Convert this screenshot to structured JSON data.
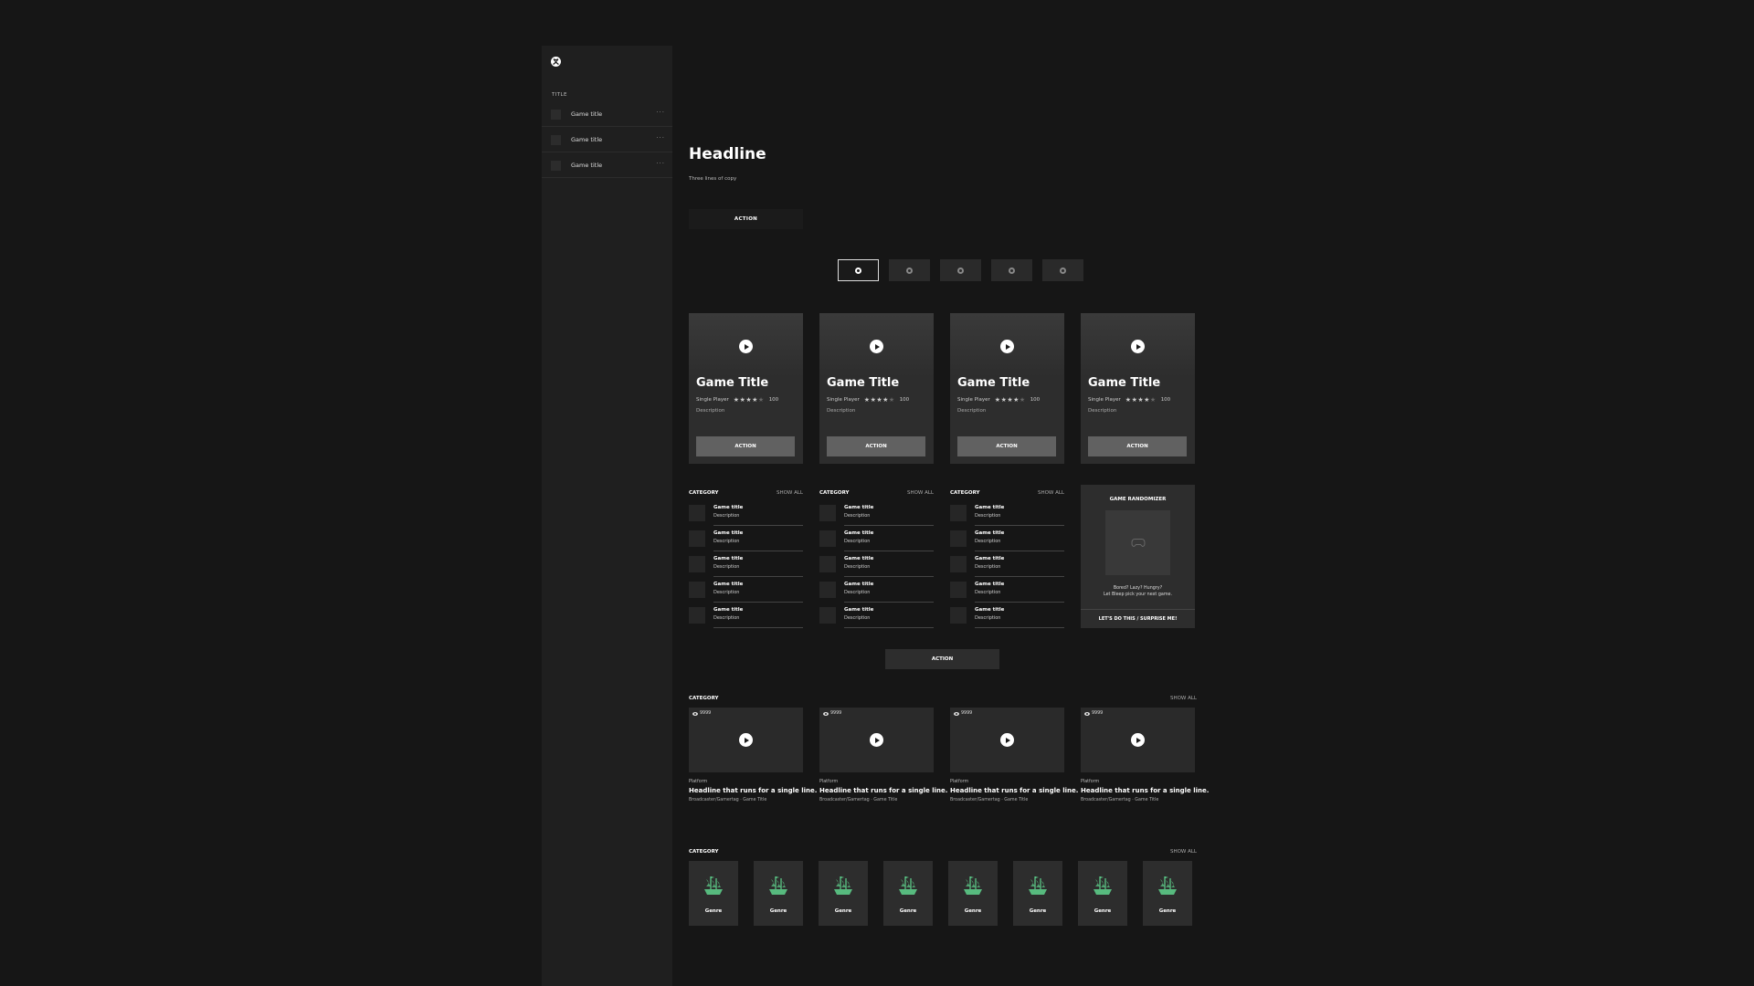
{
  "sidebar": {
    "title": "TITLE",
    "items": [
      {
        "label": "Game title",
        "more": "···"
      },
      {
        "label": "Game title",
        "more": "···"
      },
      {
        "label": "Game title",
        "more": "···"
      }
    ]
  },
  "hero": {
    "headline": "Headline",
    "copy": "Three lines of copy",
    "action": "ACTION",
    "pager_count": 5,
    "pager_active": 0
  },
  "game_cards": [
    {
      "title": "Game Title",
      "mode": "Single Player",
      "rating": 4,
      "rating_max": 5,
      "score": "100",
      "description": "Description",
      "action": "ACTION"
    },
    {
      "title": "Game Title",
      "mode": "Single Player",
      "rating": 4,
      "rating_max": 5,
      "score": "100",
      "description": "Description",
      "action": "ACTION"
    },
    {
      "title": "Game Title",
      "mode": "Single Player",
      "rating": 4,
      "rating_max": 5,
      "score": "100",
      "description": "Description",
      "action": "ACTION"
    },
    {
      "title": "Game Title",
      "mode": "Single Player",
      "rating": 4,
      "rating_max": 5,
      "score": "100",
      "description": "Description",
      "action": "ACTION"
    }
  ],
  "lists": [
    {
      "category": "CATEGORY",
      "show_all": "SHOW ALL",
      "items": [
        {
          "title": "Game title",
          "description": "Description"
        },
        {
          "title": "Game title",
          "description": "Description"
        },
        {
          "title": "Game title",
          "description": "Description"
        },
        {
          "title": "Game title",
          "description": "Description"
        },
        {
          "title": "Game title",
          "description": "Description"
        }
      ]
    },
    {
      "category": "CATEGORY",
      "show_all": "SHOW ALL",
      "items": [
        {
          "title": "Game title",
          "description": "Description"
        },
        {
          "title": "Game title",
          "description": "Description"
        },
        {
          "title": "Game title",
          "description": "Description"
        },
        {
          "title": "Game title",
          "description": "Description"
        },
        {
          "title": "Game title",
          "description": "Description"
        }
      ]
    },
    {
      "category": "CATEGORY",
      "show_all": "SHOW ALL",
      "items": [
        {
          "title": "Game title",
          "description": "Description"
        },
        {
          "title": "Game title",
          "description": "Description"
        },
        {
          "title": "Game title",
          "description": "Description"
        },
        {
          "title": "Game title",
          "description": "Description"
        },
        {
          "title": "Game title",
          "description": "Description"
        }
      ]
    }
  ],
  "randomizer": {
    "title": "GAME RANDOMIZER",
    "line1": "Bored? Lazy? Hungry?",
    "line2": "Let Bleep pick your next game.",
    "action": "LET'S DO THIS / SURPRISE ME!"
  },
  "mid_action": "ACTION",
  "videos": {
    "category": "CATEGORY",
    "show_all": "SHOW ALL",
    "items": [
      {
        "views": "9999",
        "platform": "Platform",
        "headline": "Headline that runs for a single line.",
        "meta": "Broadcaster/Gamertag  ·  Game Title"
      },
      {
        "views": "9999",
        "platform": "Platform",
        "headline": "Headline that runs for a single line.",
        "meta": "Broadcaster/Gamertag  ·  Game Title"
      },
      {
        "views": "9999",
        "platform": "Platform",
        "headline": "Headline that runs for a single line.",
        "meta": "Broadcaster/Gamertag  ·  Game Title"
      },
      {
        "views": "9999",
        "platform": "Platform",
        "headline": "Headline that runs for a single line.",
        "meta": "Broadcaster/Gamertag  ·  Game Title"
      }
    ]
  },
  "genres": {
    "category": "CATEGORY",
    "show_all": "SHOW ALL",
    "items": [
      "Genre",
      "Genre",
      "Genre",
      "Genre",
      "Genre",
      "Genre",
      "Genre",
      "Genre"
    ]
  },
  "colors": {
    "background": "#161616",
    "sidebar": "#1f1f1f",
    "card": "#2d2d2d",
    "genre_icon": "#5fd38d"
  }
}
